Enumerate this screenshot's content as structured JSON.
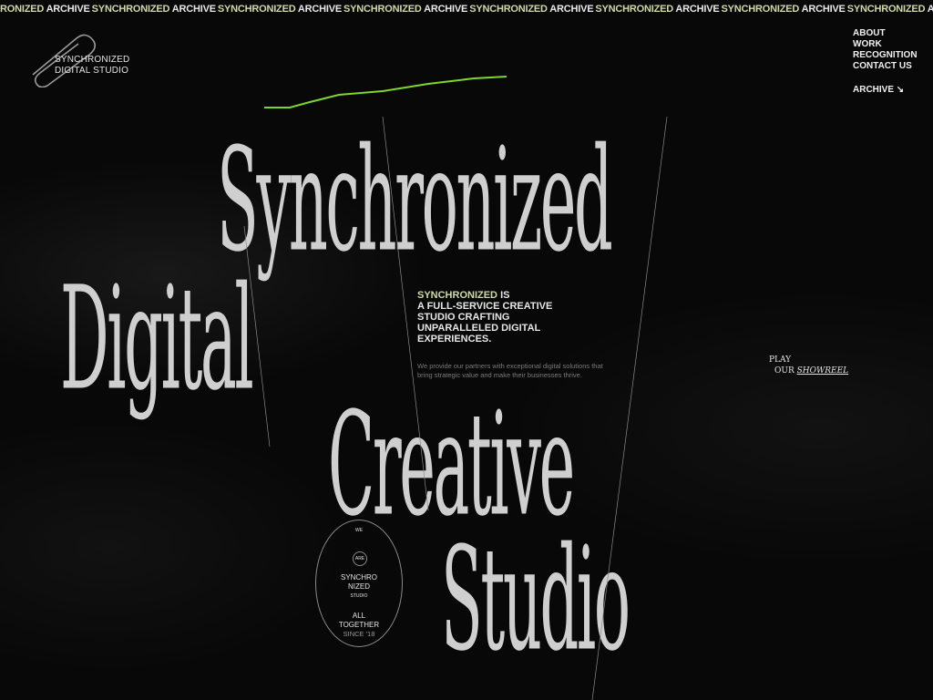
{
  "marquee": {
    "items": [
      {
        "a": "RONIZED",
        "b": "ARCHIVE"
      },
      {
        "a": "SYNCHRONIZED",
        "b": "ARCHIVE"
      },
      {
        "a": "SYNCHRONIZED",
        "b": "ARCHIVE"
      },
      {
        "a": "SYNCHRONIZED",
        "b": "ARCHIVE"
      },
      {
        "a": "SYNCHRONIZED",
        "b": "ARCHIVE"
      },
      {
        "a": "SYNCHRONIZED",
        "b": "ARCHIVE"
      },
      {
        "a": "SYNCHRONIZED",
        "b": "ARCHIVE"
      },
      {
        "a": "SYNCHRONIZED",
        "b": "ARCHIVE"
      }
    ]
  },
  "brand": {
    "line1": "SYNCHRONIZED",
    "line2": "DIGITAL STUDIO"
  },
  "nav": {
    "items": [
      "ABOUT",
      "WORK",
      "RECOGNITION",
      "CONTACT US"
    ],
    "archive": "ARCHIVE ↘"
  },
  "hero": {
    "line1": "Synchronized",
    "line2": "Digital",
    "line3": "Creative",
    "line4": "Studio"
  },
  "intro": {
    "accent": "SYNCHRONIZED",
    "line1_rest": " IS",
    "line2": "A FULL-SERVICE CREATIVE",
    "line3": "STUDIO CRAFTING",
    "line4": "UNPARALLELED DIGITAL",
    "line5": "EXPERIENCES.",
    "description": "We provide our partners with exceptional digital solutions that bring strategic value and make their businesses thrive."
  },
  "showreel": {
    "play": "PLAY",
    "our": "OUR",
    "showreel": "SHOWREEL"
  },
  "badge": {
    "we": "WE",
    "are": "ARE",
    "syn1": "SYNCHRO",
    "syn2": "NIZED",
    "studio": "STUDIO",
    "all1": "ALL",
    "all2": "TOGETHER",
    "since": "SINCE '18"
  },
  "colors": {
    "accent": "#cfd9a8",
    "line": "#7dd62a",
    "background": "#080808"
  }
}
